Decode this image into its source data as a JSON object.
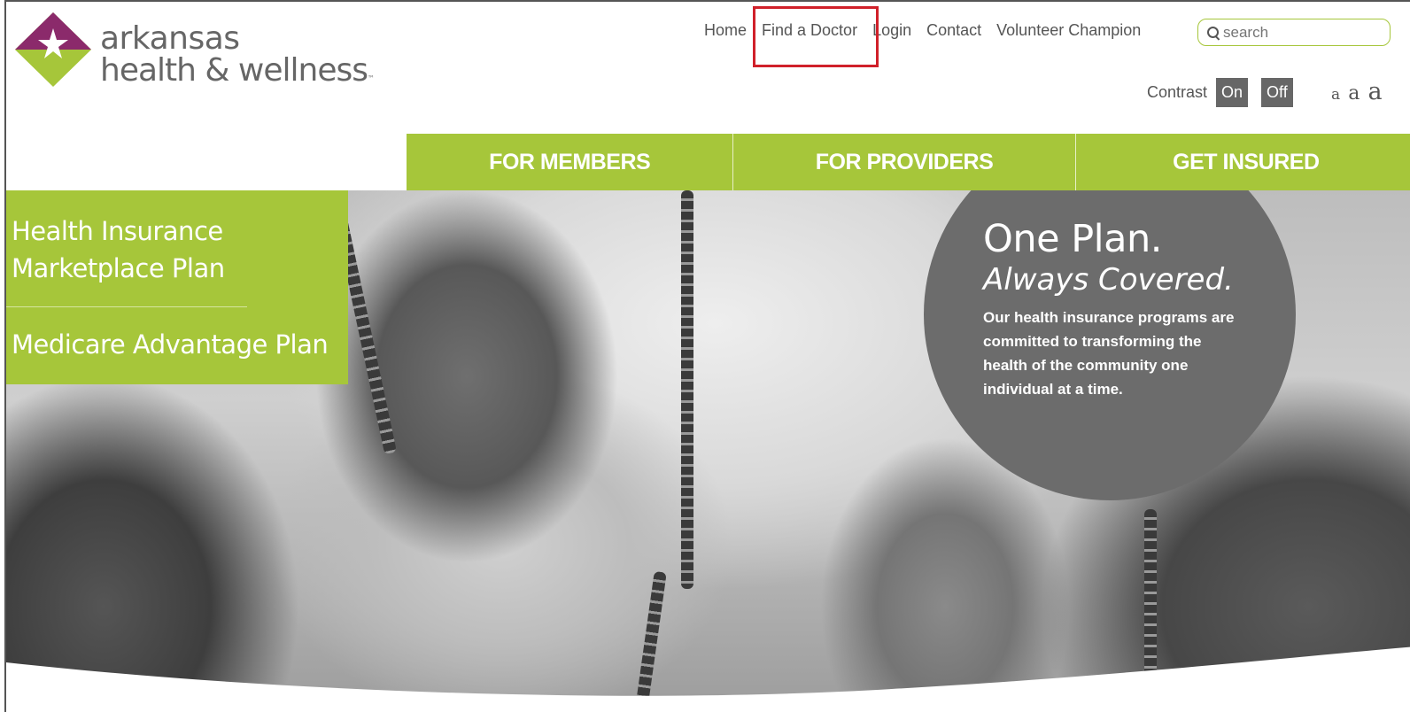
{
  "brand": {
    "line1": "arkansas",
    "line2": "health & wellness",
    "trademark": "™",
    "colors": {
      "green": "#a6c63a",
      "purple": "#8b2a6b",
      "gray": "#666666",
      "highlight": "#d0202a"
    }
  },
  "util_nav": {
    "items": [
      "Home",
      "Find a Doctor",
      "Login",
      "Contact",
      "Volunteer Champion"
    ]
  },
  "search": {
    "placeholder": "search"
  },
  "contrast": {
    "label": "Contrast",
    "on": "On",
    "off": "Off"
  },
  "font_sizes": [
    "a",
    "a",
    "a"
  ],
  "main_nav": {
    "items": [
      "FOR MEMBERS",
      "FOR PROVIDERS",
      "GET INSURED"
    ]
  },
  "plans": [
    "Health Insurance Marketplace Plan",
    "Medicare Advantage Plan"
  ],
  "hero": {
    "title": "One Plan.",
    "subtitle": "Always Covered.",
    "text": "Our health insurance programs are committed to transforming the health of the community one individual at a time."
  }
}
